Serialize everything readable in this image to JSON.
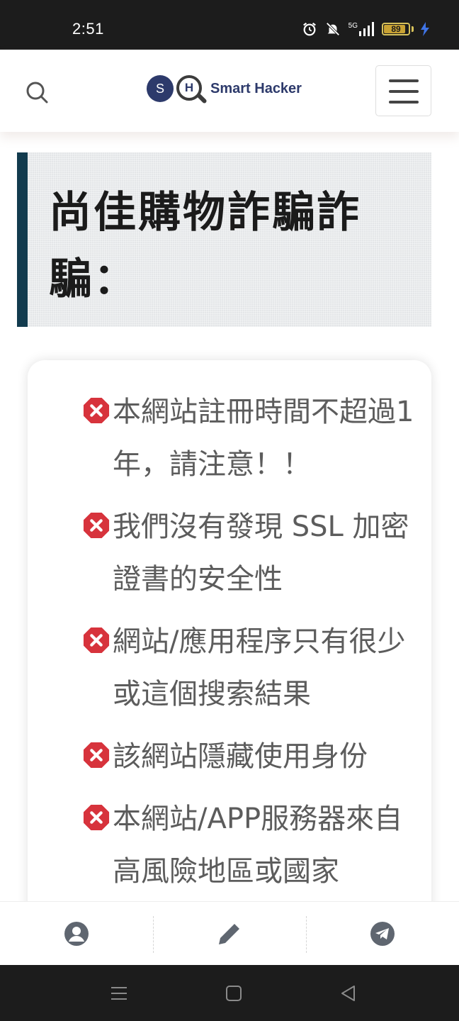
{
  "status_bar": {
    "time": "2:51",
    "network": "5G",
    "battery": "89",
    "battery_fraction": 0.89,
    "icons": [
      "alarm-icon",
      "mute-icon",
      "signal-icon",
      "battery-icon",
      "charging-icon"
    ]
  },
  "header": {
    "logo": {
      "s_letter": "S",
      "h_letter": "H",
      "text": "Smart Hacker"
    },
    "icons": [
      "search-icon",
      "hamburger-menu-icon"
    ]
  },
  "title": "尚佳購物詐騙詐騙：",
  "warnings": [
    {
      "text": "本網站註冊時間不超過1年，請注意！！"
    },
    {
      "text": "我們沒有發現 SSL 加密證書的安全性"
    },
    {
      "text": "網站/應用程序只有很少或這個搜索結果"
    },
    {
      "text": "該網站隱藏使用身份"
    },
    {
      "text": "本網站/APP服務器來自高風險地區或國家"
    }
  ],
  "bottom_nav": [
    "account-icon",
    "pencil-icon",
    "telegram-icon"
  ],
  "colors": {
    "brand": "#2d3a6b",
    "title_accent": "#123b4e",
    "warning_red": "#d7333c",
    "nav_icon": "#5f6670"
  }
}
